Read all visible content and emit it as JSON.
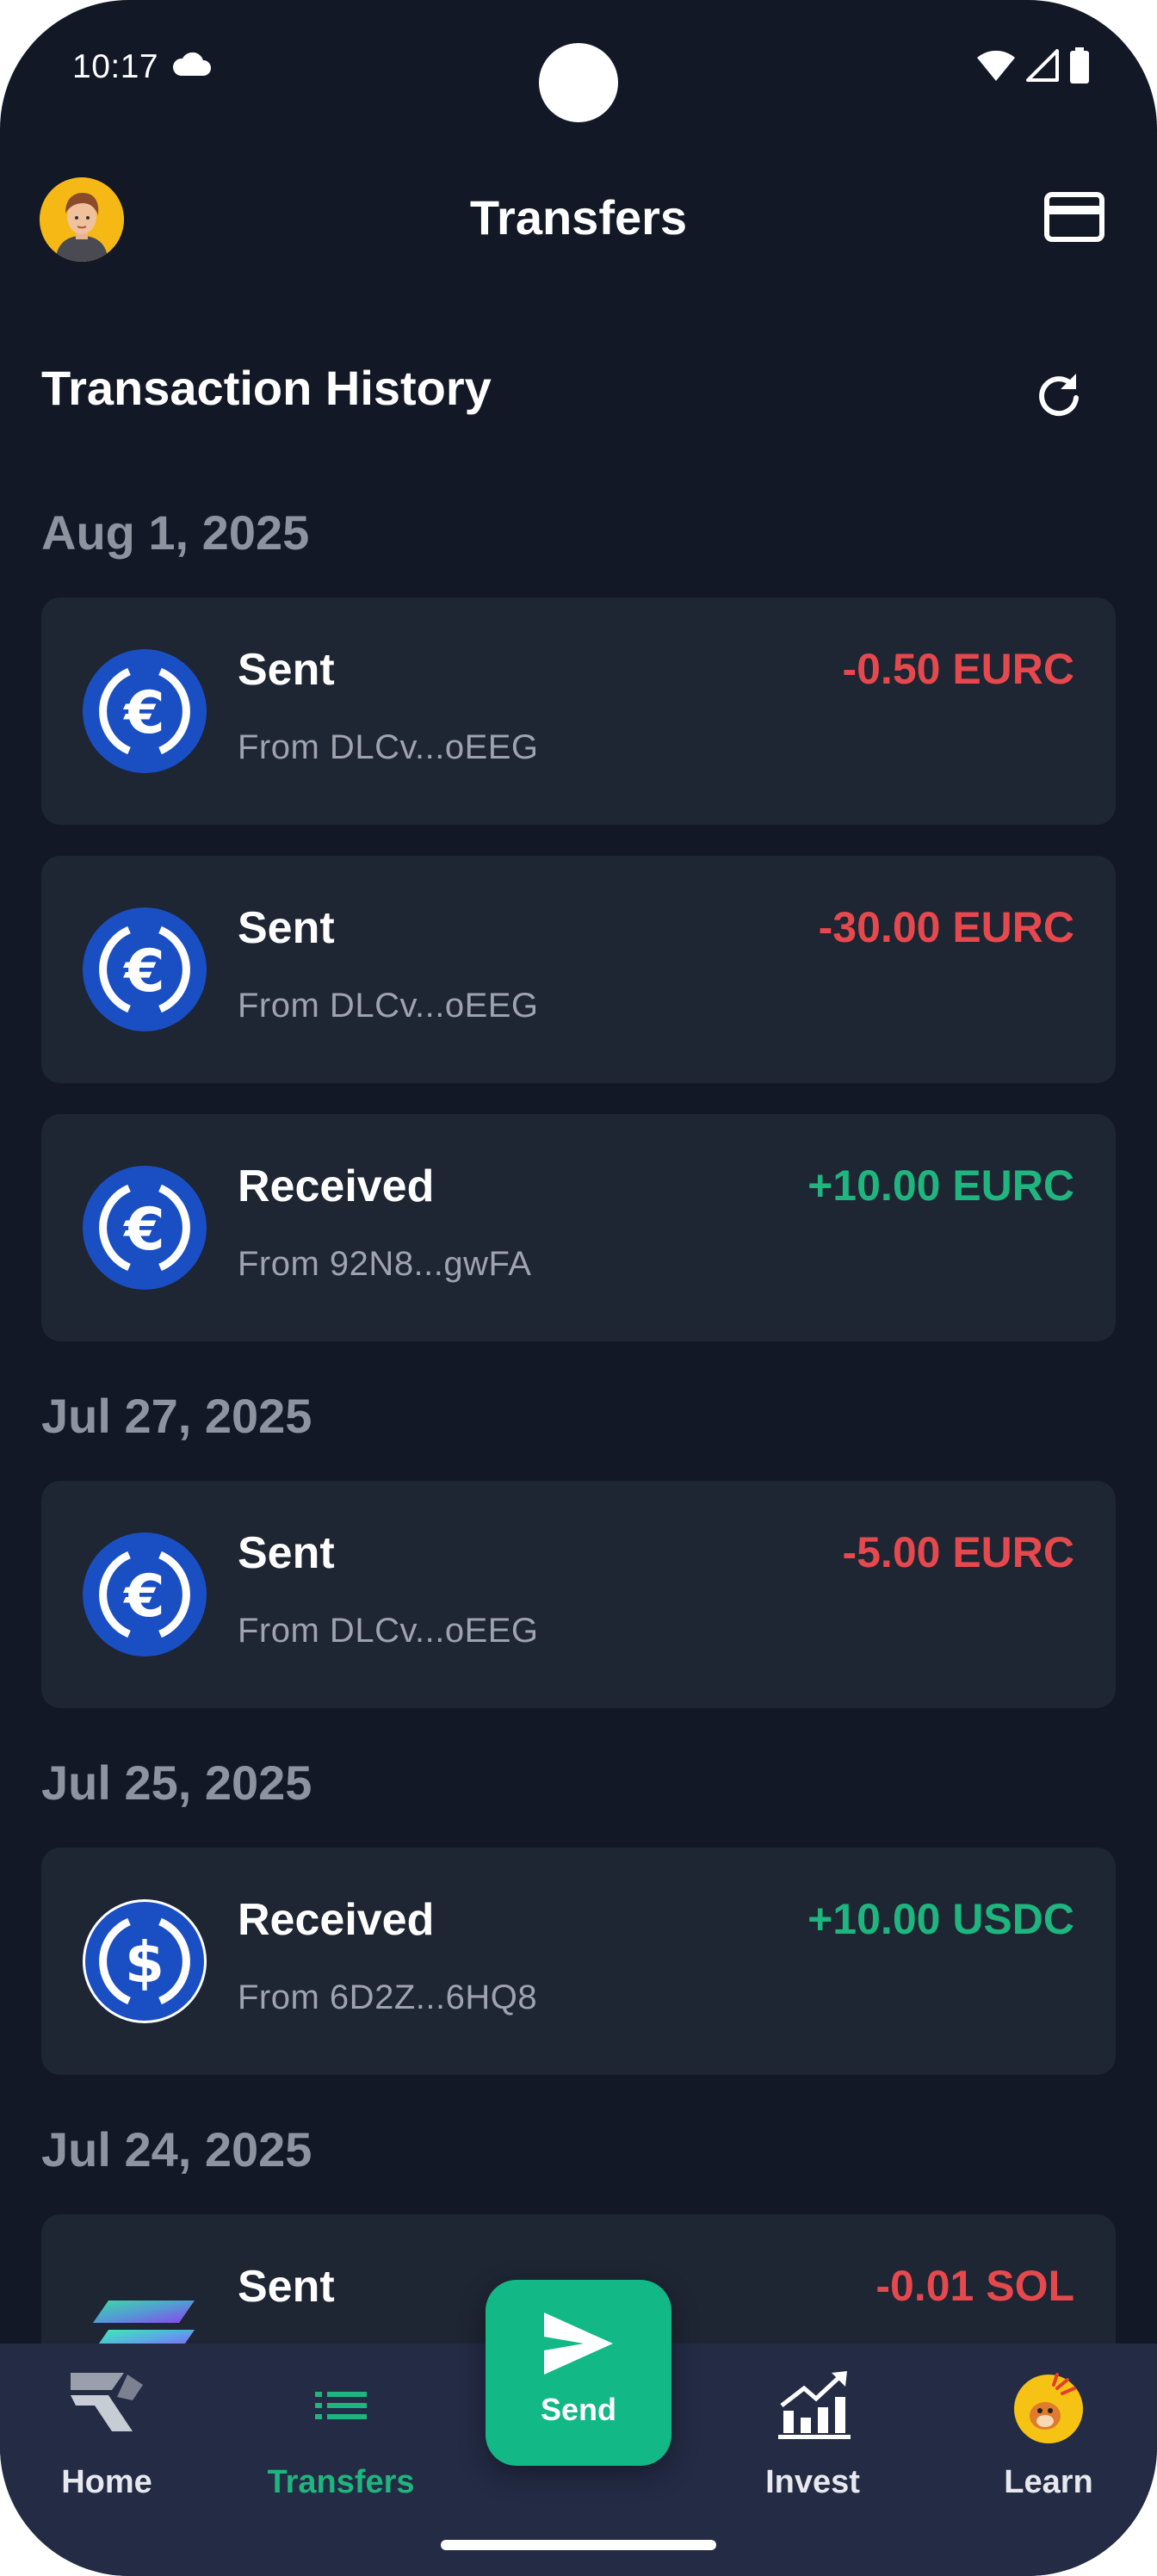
{
  "status_bar": {
    "time": "10:17",
    "icons": [
      "cloud-icon",
      "wifi-icon",
      "signal-icon",
      "battery-icon"
    ]
  },
  "header": {
    "title": "Transfers",
    "avatar_icon": "avatar",
    "card_icon": "card-icon"
  },
  "section": {
    "title": "Transaction History",
    "refresh_icon": "refresh-icon"
  },
  "groups": [
    {
      "date": "Aug 1, 2025",
      "transactions": [
        {
          "type": "Sent",
          "from": "From DLCv...oEEG",
          "amount": "-0.50 EURC",
          "direction": "negative",
          "token": "EURC"
        },
        {
          "type": "Sent",
          "from": "From DLCv...oEEG",
          "amount": "-30.00 EURC",
          "direction": "negative",
          "token": "EURC"
        },
        {
          "type": "Received",
          "from": "From 92N8...gwFA",
          "amount": "+10.00 EURC",
          "direction": "positive",
          "token": "EURC"
        }
      ]
    },
    {
      "date": "Jul 27, 2025",
      "transactions": [
        {
          "type": "Sent",
          "from": "From DLCv...oEEG",
          "amount": "-5.00 EURC",
          "direction": "negative",
          "token": "EURC"
        }
      ]
    },
    {
      "date": "Jul 25, 2025",
      "transactions": [
        {
          "type": "Received",
          "from": "From 6D2Z...6HQ8",
          "amount": "+10.00 USDC",
          "direction": "positive",
          "token": "USDC"
        }
      ]
    },
    {
      "date": "Jul 24, 2025",
      "transactions": [
        {
          "type": "Sent",
          "from": "",
          "amount": "-0.01 SOL",
          "direction": "negative",
          "token": "SOL"
        }
      ]
    }
  ],
  "bottom_nav": {
    "items": [
      {
        "label": "Home",
        "icon": "home-logo-icon",
        "active": false
      },
      {
        "label": "Transfers",
        "icon": "list-icon",
        "active": true
      },
      {
        "label": "Invest",
        "icon": "chart-icon",
        "active": false
      },
      {
        "label": "Learn",
        "icon": "learn-mascot-icon",
        "active": false
      }
    ],
    "send": {
      "label": "Send",
      "icon": "send-icon"
    }
  },
  "colors": {
    "background": "#121826",
    "card": "#1e2533",
    "negative": "#e5484d",
    "positive": "#1fb57e",
    "nav_bg": "#232b45",
    "send_button": "#12b886",
    "muted_text": "#9ea4af"
  }
}
